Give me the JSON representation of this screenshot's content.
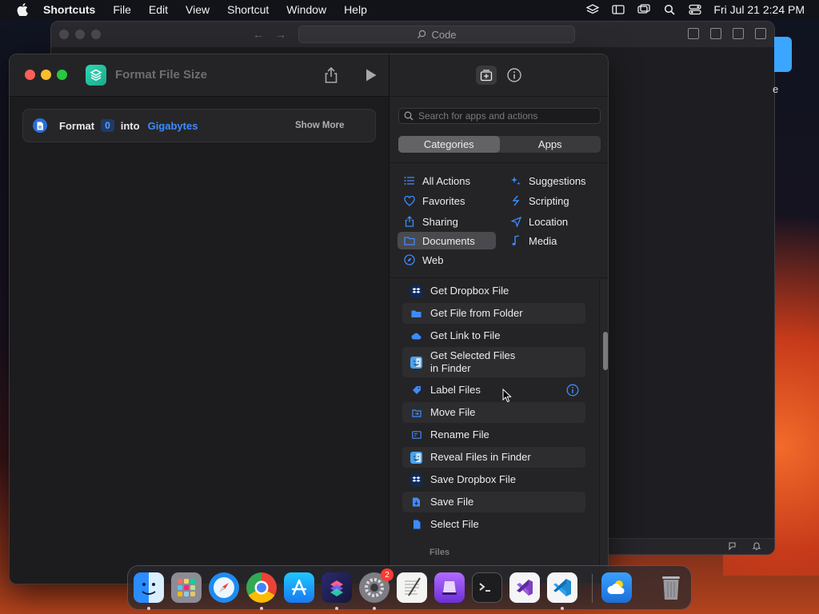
{
  "menubar": {
    "app_name": "Shortcuts",
    "menus": [
      "File",
      "Edit",
      "View",
      "Shortcut",
      "Window",
      "Help"
    ],
    "clock": "Fri Jul 21  2:24 PM"
  },
  "background_window": {
    "search_label": "Code",
    "edge_text": "e"
  },
  "window": {
    "title": "Format File Size",
    "action": {
      "verb": "Format",
      "value_token": "0",
      "connector": "into",
      "unit": "Gigabytes",
      "show_more": "Show More"
    }
  },
  "library": {
    "search_placeholder": "Search for apps and actions",
    "segments": [
      "Categories",
      "Apps"
    ],
    "active_segment": "Categories",
    "categories_left": [
      {
        "label": "All Actions",
        "icon": "list-icon"
      },
      {
        "label": "Favorites",
        "icon": "heart-icon"
      },
      {
        "label": "Sharing",
        "icon": "share-icon"
      },
      {
        "label": "Documents",
        "icon": "folder-icon"
      },
      {
        "label": "Web",
        "icon": "compass-icon"
      }
    ],
    "categories_right": [
      {
        "label": "Suggestions",
        "icon": "sparkle-icon"
      },
      {
        "label": "Scripting",
        "icon": "scripting-icon"
      },
      {
        "label": "Location",
        "icon": "location-arrow-icon"
      },
      {
        "label": "Media",
        "icon": "music-note-icon"
      }
    ],
    "selected_category": "Documents",
    "actions": [
      {
        "label": "Get Dropbox File",
        "icon": "dropbox-icon"
      },
      {
        "label": "Get File from Folder",
        "icon": "folder-icon"
      },
      {
        "label": "Get Link to File",
        "icon": "cloud-icon"
      },
      {
        "label_line1": "Get Selected Files",
        "label_line2": "in Finder",
        "icon": "finder-icon"
      },
      {
        "label": "Label Files",
        "icon": "tag-icon"
      },
      {
        "label": "Move File",
        "icon": "move-file-icon"
      },
      {
        "label": "Rename File",
        "icon": "rename-icon"
      },
      {
        "label": "Reveal Files in Finder",
        "icon": "finder-icon"
      },
      {
        "label": "Save Dropbox File",
        "icon": "dropbox-icon"
      },
      {
        "label": "Save File",
        "icon": "save-file-icon"
      },
      {
        "label": "Select File",
        "icon": "document-icon"
      }
    ],
    "section_header": "Files"
  },
  "dock": {
    "apps": [
      "Finder",
      "Launchpad",
      "Safari",
      "Chrome",
      "App Store",
      "Shortcuts",
      "System Settings",
      "TextEdit",
      "Apple Configurator",
      "Terminal",
      "Visual Studio",
      "VS Code",
      "Weather",
      "Trash"
    ],
    "settings_badge": "2"
  },
  "colors": {
    "accent": "#3d8bff",
    "shortcuts_green": "#2fd6b4",
    "selected_category_bg": "#4a4a4e"
  }
}
